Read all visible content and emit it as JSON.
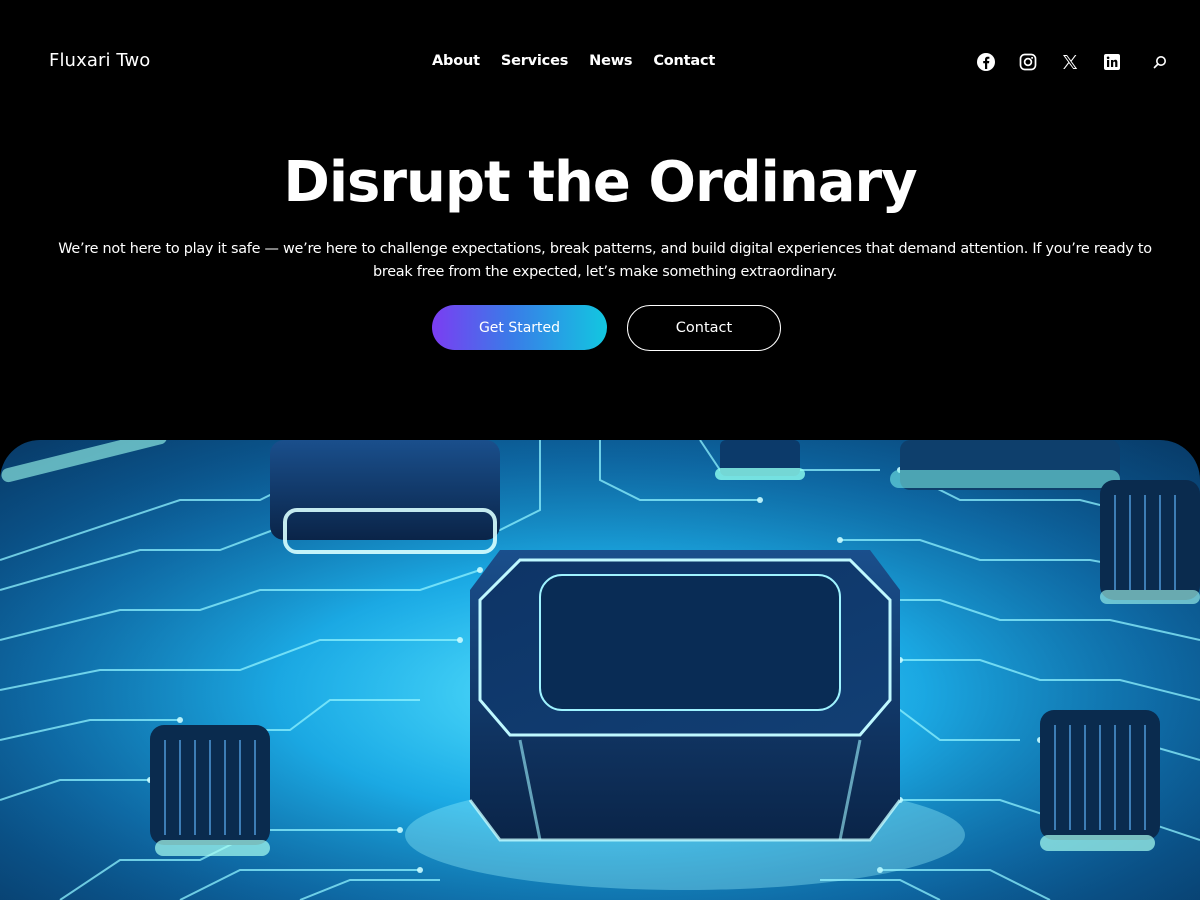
{
  "header": {
    "site_title": "Fluxari Two",
    "nav": [
      {
        "label": "About"
      },
      {
        "label": "Services"
      },
      {
        "label": "News"
      },
      {
        "label": "Contact"
      }
    ],
    "social_icons": [
      "facebook-icon",
      "instagram-icon",
      "x-icon",
      "linkedin-icon",
      "search-icon"
    ]
  },
  "hero": {
    "title": "Disrupt the Ordinary",
    "text": "We’re not here to play it safe — we’re here to challenge expectations, break patterns, and build digital experiences that demand attention. If you’re ready to break free from the expected, let’s make something extraordinary.",
    "primary_button": "Get Started",
    "secondary_button": "Contact"
  },
  "colors": {
    "background": "#000000",
    "text": "#ffffff",
    "gradient_start": "#7b3df2",
    "gradient_end": "#12c7e0",
    "image_glow": "#37d0f4"
  }
}
